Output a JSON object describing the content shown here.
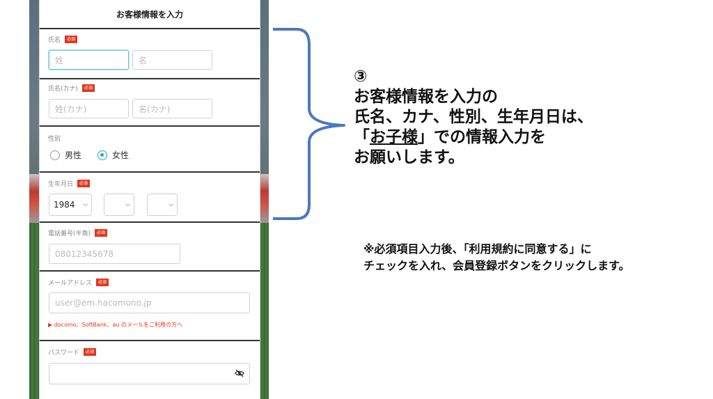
{
  "form": {
    "title": "お客様情報を入力",
    "required_badge": "必須",
    "name": {
      "label": "氏名",
      "last_placeholder": "姓",
      "first_placeholder": "名"
    },
    "kana": {
      "label": "氏名(カナ)",
      "last_placeholder": "姓(カナ)",
      "first_placeholder": "名(カナ)"
    },
    "gender": {
      "label": "性別",
      "options": [
        "男性",
        "女性"
      ],
      "selected": "女性"
    },
    "birthdate": {
      "label": "生年月日",
      "year": "1984",
      "month": "",
      "day": ""
    },
    "phone": {
      "label": "電話番号(半角)",
      "placeholder": "08012345678"
    },
    "email": {
      "label": "メールアドレス",
      "placeholder": "user@em.hacomono.jp",
      "carrier_link": "▶ docomo、SoftBank、au のメールをご利用の方へ"
    },
    "password": {
      "label": "パスワード",
      "placeholder": ""
    }
  },
  "annotation": {
    "marker": "③",
    "line1": "お客様情報を入力の",
    "line2": "氏名、カナ、性別、生年月日は、",
    "line3_pre": "「",
    "line3_underlined": "お子様",
    "line3_post": "」での情報入力を",
    "line4": "お願いします。",
    "note_line1": "※必須項目入力後、「利用規約に同意する」に",
    "note_line2": "チェックを入れ、会員登録ボタンをクリックします。"
  },
  "colors": {
    "accent": "#24a7b8",
    "required": "#e1371d",
    "bracket": "#4a78c2"
  },
  "icons": {
    "password_toggle": "eye-off-icon",
    "select_arrow": "chevron-down-icon"
  }
}
